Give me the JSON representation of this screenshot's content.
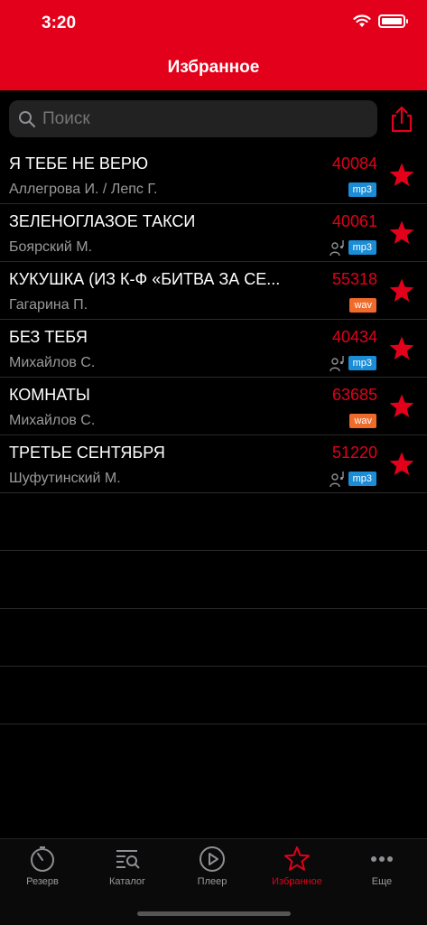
{
  "status": {
    "time": "3:20"
  },
  "header": {
    "title": "Избранное"
  },
  "search": {
    "placeholder": "Поиск"
  },
  "colors": {
    "accent": "#e3001b",
    "mp3": "#1a8dd6",
    "wav": "#f06a2a"
  },
  "favorites": [
    {
      "title": "Я ТЕБЕ НЕ ВЕРЮ",
      "artist": "Аллегрова И. / Лепс Г.",
      "code": "40084",
      "format": "mp3",
      "has_backing": false
    },
    {
      "title": "ЗЕЛЕНОГЛАЗОЕ ТАКСИ",
      "artist": "Боярский М.",
      "code": "40061",
      "format": "mp3",
      "has_backing": true
    },
    {
      "title": "КУКУШКА (ИЗ К-Ф «БИТВА ЗА СЕ...",
      "artist": "Гагарина П.",
      "code": "55318",
      "format": "wav",
      "has_backing": false
    },
    {
      "title": "БЕЗ ТЕБЯ",
      "artist": "Михайлов С.",
      "code": "40434",
      "format": "mp3",
      "has_backing": true
    },
    {
      "title": "КОМНАТЫ",
      "artist": "Михайлов С.",
      "code": "63685",
      "format": "wav",
      "has_backing": false
    },
    {
      "title": "ТРЕТЬЕ СЕНТЯБРЯ",
      "artist": "Шуфутинский М.",
      "code": "51220",
      "format": "mp3",
      "has_backing": true
    }
  ],
  "tabs": [
    {
      "label": "Резерв",
      "icon": "timer-icon",
      "active": false
    },
    {
      "label": "Каталог",
      "icon": "catalog-icon",
      "active": false
    },
    {
      "label": "Плеер",
      "icon": "play-icon",
      "active": false
    },
    {
      "label": "Избранное",
      "icon": "star-icon",
      "active": true
    },
    {
      "label": "Еще",
      "icon": "more-icon",
      "active": false
    }
  ]
}
